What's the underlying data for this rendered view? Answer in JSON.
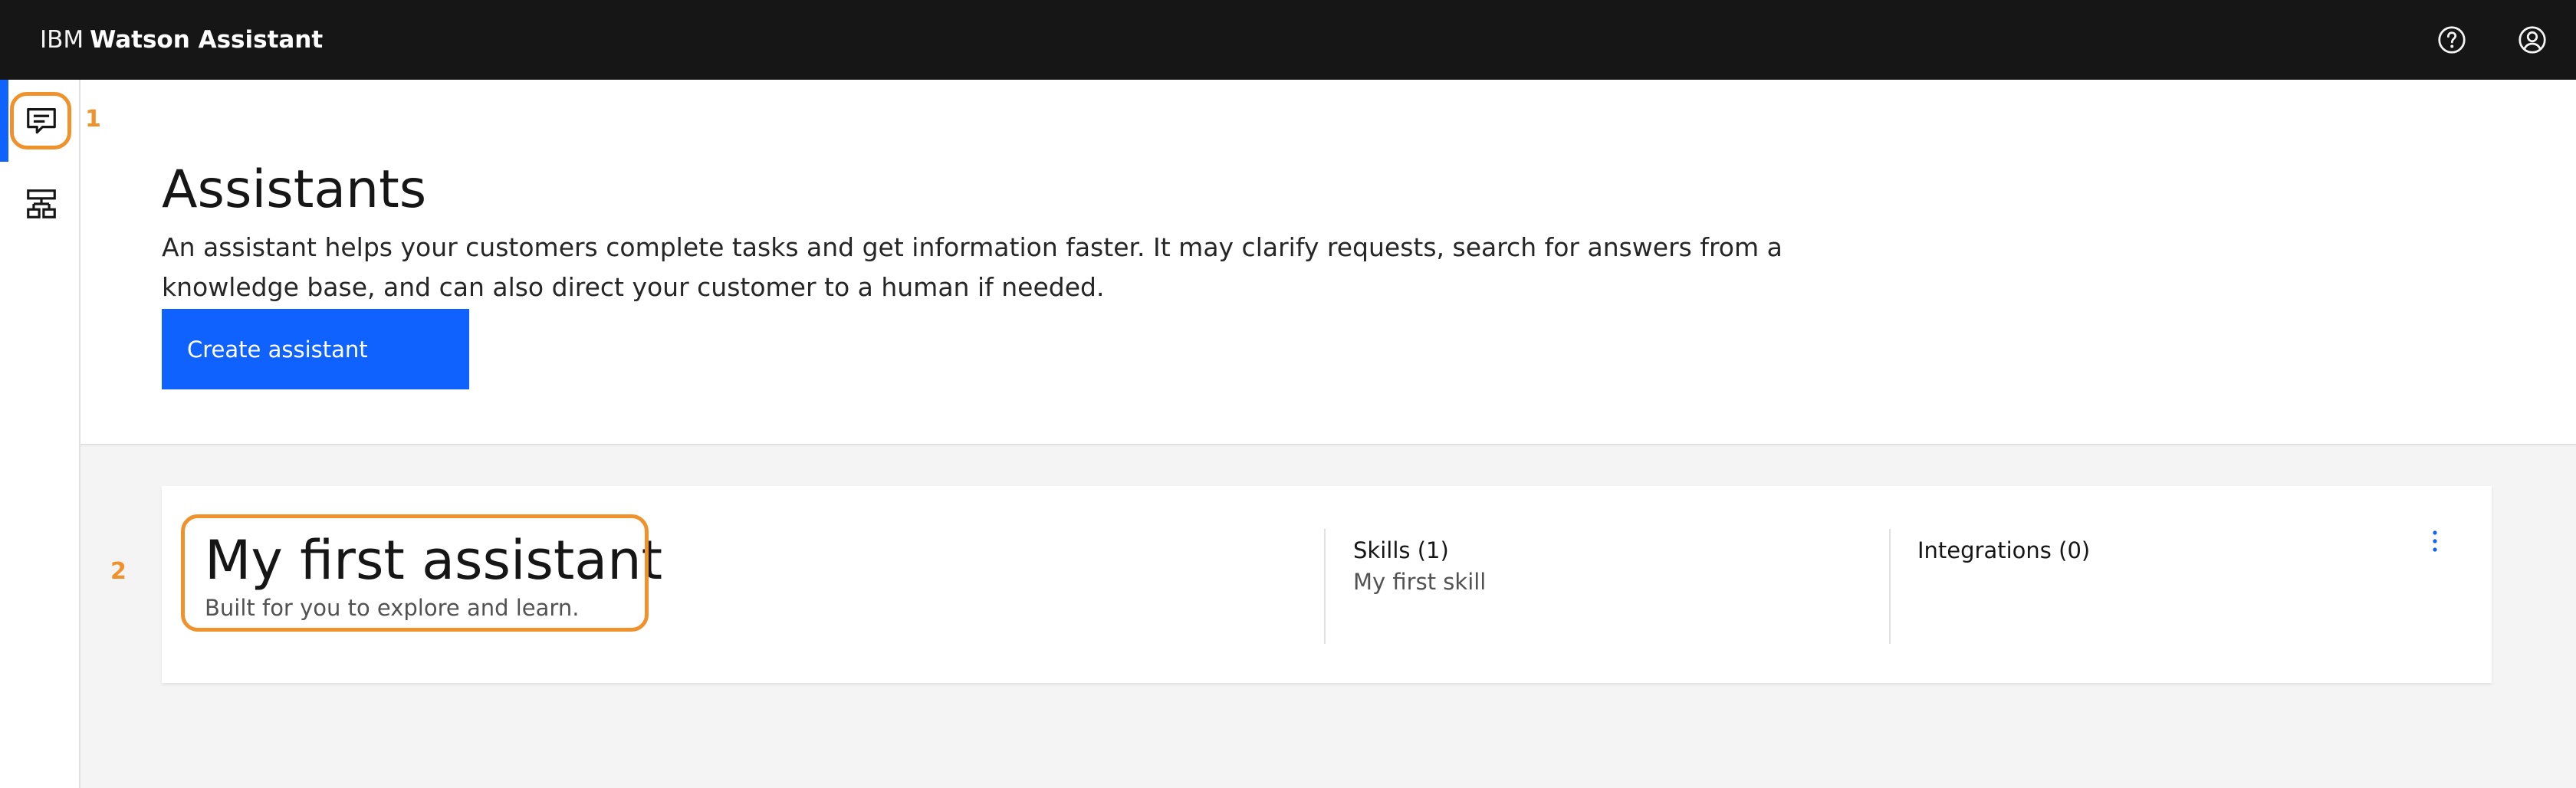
{
  "header": {
    "brand_prefix": "IBM",
    "brand_name": "Watson Assistant",
    "icons": [
      "help-icon",
      "user-avatar-icon"
    ]
  },
  "sidenav": {
    "items": [
      {
        "icon": "chat-icon",
        "active": true
      },
      {
        "icon": "skills-tree-icon",
        "active": false
      }
    ]
  },
  "annotations": [
    "1",
    "2"
  ],
  "main": {
    "title": "Assistants",
    "description": "An assistant helps your customers complete tasks and get information faster. It may clarify requests, search for answers from a knowledge base, and can also direct your customer to a human if needed.",
    "create_button": "Create assistant"
  },
  "assistants": [
    {
      "name": "My first assistant",
      "description": "Built for you to explore and learn.",
      "skills_heading": "Skills (1)",
      "skills": [
        "My first skill"
      ],
      "integrations_heading": "Integrations (0)"
    }
  ],
  "colors": {
    "header_bg": "#161616",
    "primary_blue": "#0f62fe",
    "annotation_orange": "#f0922b",
    "content_gray": "#f4f4f4"
  }
}
